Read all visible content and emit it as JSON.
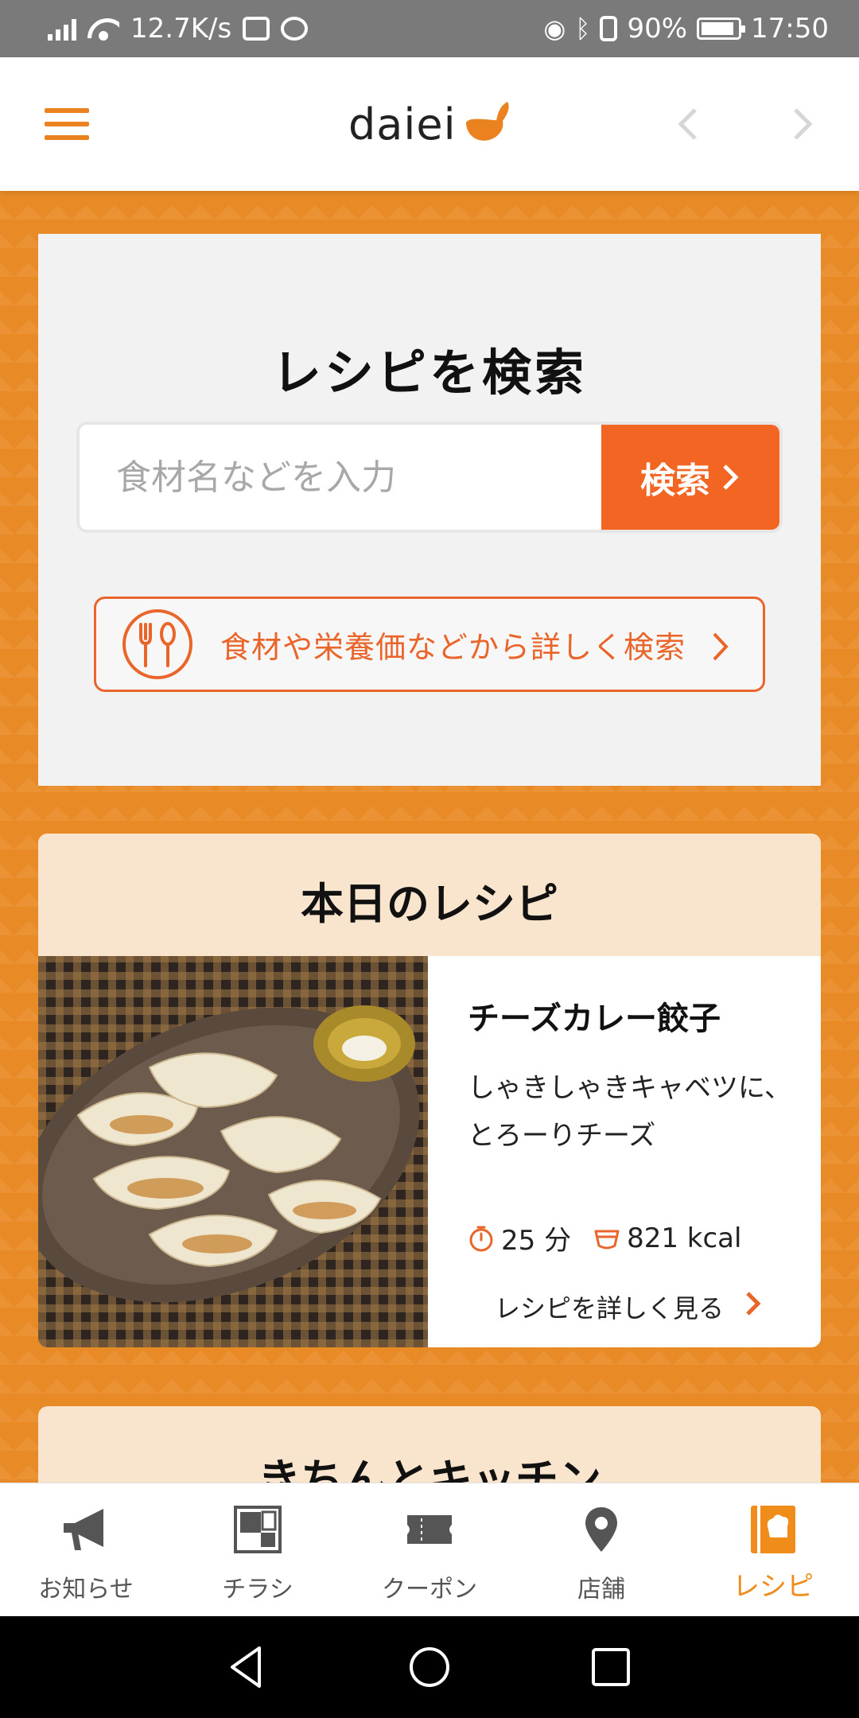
{
  "status_bar": {
    "speed": "12.7K/s",
    "battery": "90%",
    "time": "17:50"
  },
  "header": {
    "logo": "daiei",
    "brand_color": "#ea8220"
  },
  "search": {
    "title": "レシピを検索",
    "placeholder": "食材名などを入力",
    "button_label": "検索",
    "advanced_label": "食材や栄養価などから詳しく検索",
    "accent_color": "#f26522"
  },
  "today": {
    "title": "本日のレシピ",
    "recipe_name": "チーズカレー餃子",
    "description_line1": "しゃきしゃきキャベツに、",
    "description_line2": "とろーりチーズ",
    "time": "25 分",
    "calories": "821 kcal",
    "link_label": "レシピを詳しく見る"
  },
  "kitchen": {
    "title": "きちんとキッチン"
  },
  "tabs": [
    {
      "label": "お知らせ",
      "icon": "megaphone-icon"
    },
    {
      "label": "チラシ",
      "icon": "flyer-icon"
    },
    {
      "label": "クーポン",
      "icon": "coupon-icon"
    },
    {
      "label": "店舗",
      "icon": "location-pin-icon"
    },
    {
      "label": "レシピ",
      "icon": "recipe-book-icon",
      "active": true
    }
  ]
}
